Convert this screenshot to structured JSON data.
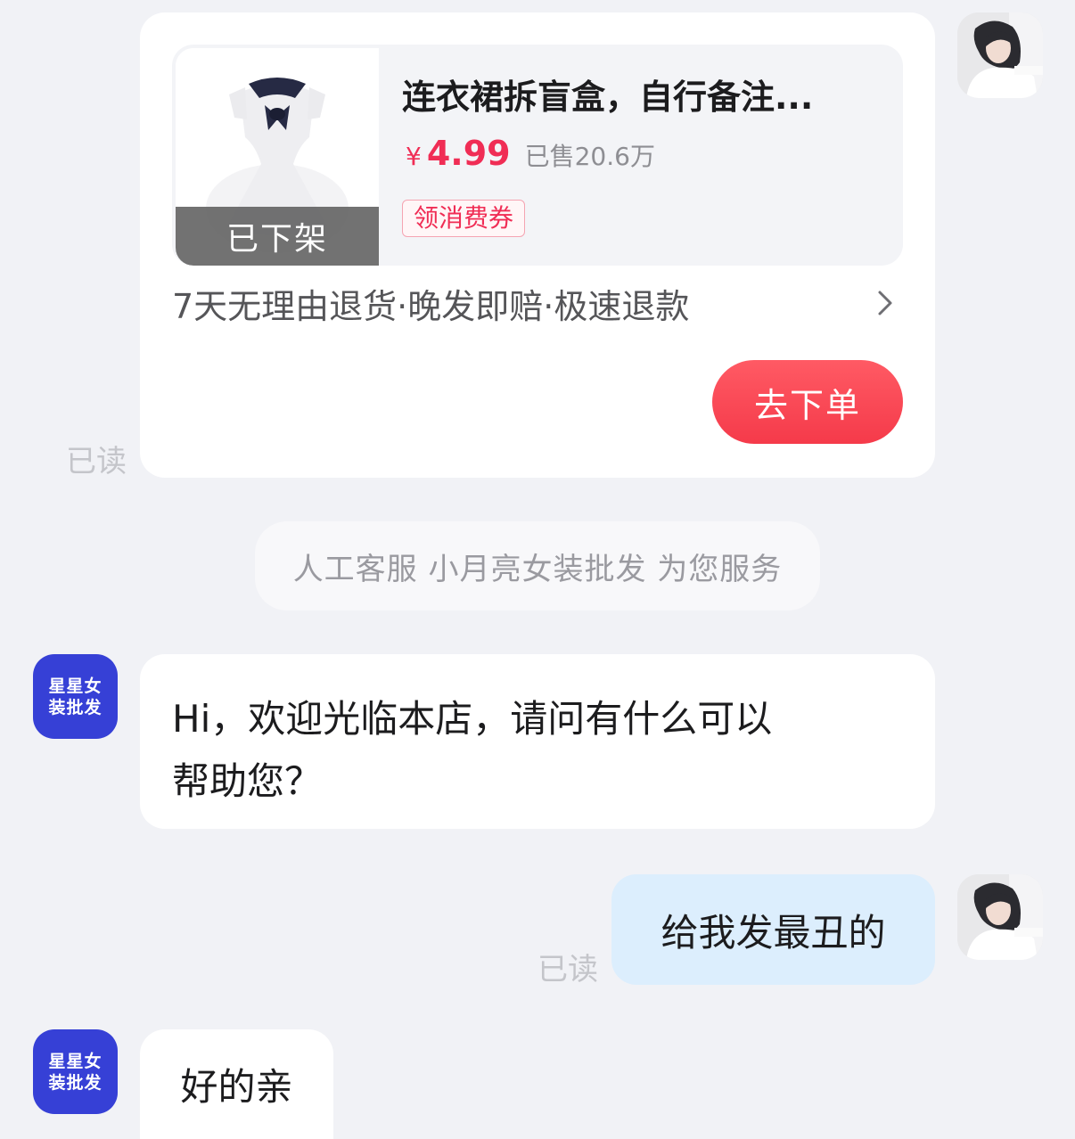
{
  "product_card": {
    "title": "连衣裙拆盲盒，自行备注...",
    "price_symbol": "¥",
    "price": "4.99",
    "sold": "已售20.6万",
    "coupon": "领消费券",
    "status_overlay": "已下架",
    "service": "7天无理由退货·晚发即赔·极速退款",
    "order_button": "去下单",
    "accent_color": "#f02d55"
  },
  "read_status": "已读",
  "system_notice": "人工客服 小月亮女装批发 为您服务",
  "shop": {
    "avatar_line1": "星星女",
    "avatar_line2": "装批发"
  },
  "messages": [
    {
      "from": "shop",
      "text_line1": "Hi，欢迎光临本店，请问有什么可以",
      "text_line2": "帮助您？"
    },
    {
      "from": "user",
      "text": "给我发最丑的"
    },
    {
      "from": "shop",
      "text": "好的亲"
    }
  ]
}
